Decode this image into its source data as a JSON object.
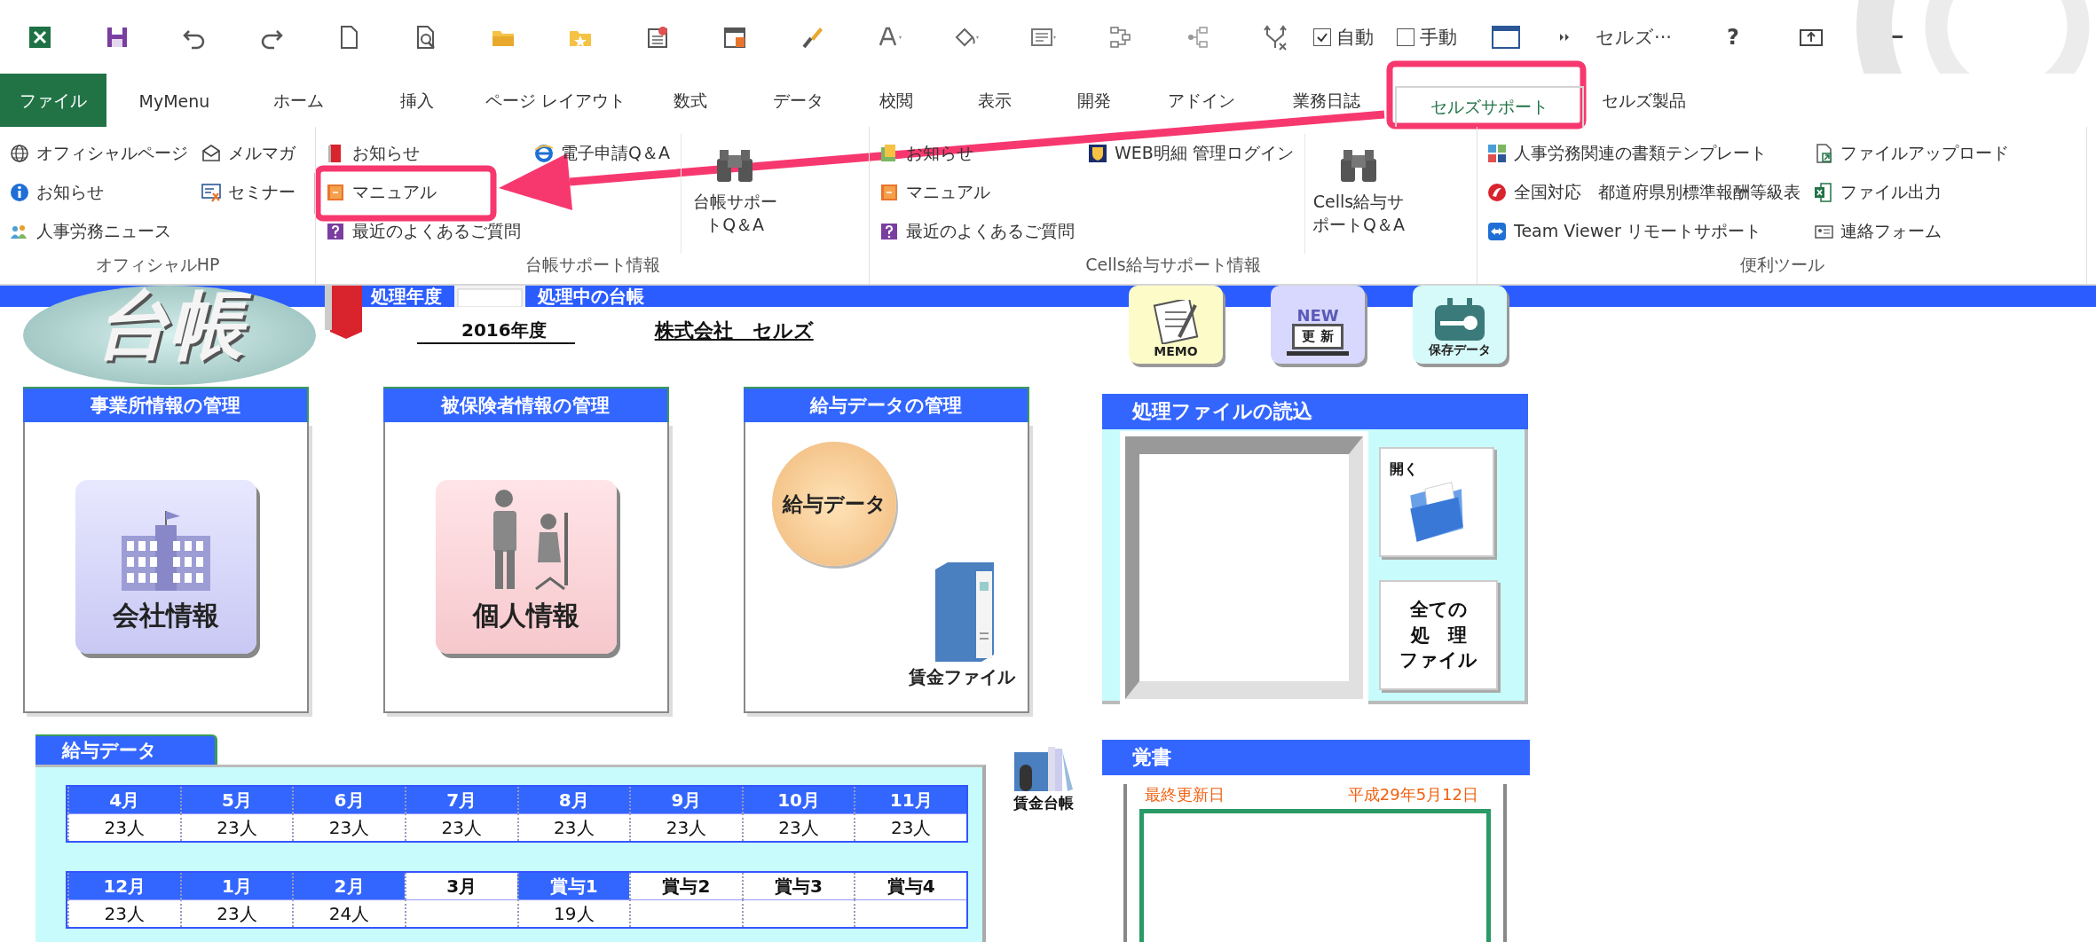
{
  "quick_access": {
    "toggles": [
      {
        "label": "自動",
        "checked": true
      },
      {
        "label": "手動",
        "checked": false
      }
    ],
    "account": "セルズ···",
    "help": "?"
  },
  "tabs": [
    {
      "label": "ファイル",
      "kind": "file",
      "selected": false
    },
    {
      "label": "MyMenu",
      "kind": "tab",
      "selected": false
    },
    {
      "label": "ホーム",
      "kind": "tab",
      "selected": false
    },
    {
      "label": "挿入",
      "kind": "tab",
      "selected": false
    },
    {
      "label": "ページ レイアウト",
      "kind": "tab",
      "selected": false
    },
    {
      "label": "数式",
      "kind": "tab",
      "selected": false
    },
    {
      "label": "データ",
      "kind": "tab",
      "selected": false
    },
    {
      "label": "校閲",
      "kind": "tab",
      "selected": false
    },
    {
      "label": "表示",
      "kind": "tab",
      "selected": false
    },
    {
      "label": "開発",
      "kind": "tab",
      "selected": false
    },
    {
      "label": "アドイン",
      "kind": "tab",
      "selected": false
    },
    {
      "label": "業務日誌",
      "kind": "tab",
      "selected": false
    },
    {
      "label": "セルズサポート",
      "kind": "tab",
      "selected": true
    },
    {
      "label": "セルズ製品",
      "kind": "tab",
      "selected": false
    }
  ],
  "ribbon": {
    "groups": [
      {
        "title": "オフィシャルHP",
        "columns": [
          {
            "kind": "small",
            "items": [
              "オフィシャルページ",
              "お知らせ",
              "人事労務ニュース"
            ]
          },
          {
            "kind": "small",
            "items": [
              "メルマガ",
              "セミナー"
            ]
          }
        ]
      },
      {
        "title": "台帳サポート情報",
        "columns": [
          {
            "kind": "small",
            "items": [
              "お知らせ",
              "マニュアル",
              "最近のよくあるご質問"
            ]
          },
          {
            "kind": "small",
            "items": [
              "電子申請Q＆A"
            ]
          },
          {
            "kind": "large",
            "items": [
              "台帳サポートQ＆A"
            ]
          }
        ]
      },
      {
        "title": "Cells給与サポート情報",
        "columns": [
          {
            "kind": "small",
            "items": [
              "お知らせ",
              "マニュアル",
              "最近のよくあるご質問"
            ]
          },
          {
            "kind": "small",
            "items": [
              "WEB明細 管理ログイン"
            ]
          },
          {
            "kind": "large",
            "items": [
              "Cells給与サポートQ＆A"
            ]
          }
        ]
      },
      {
        "title": "便利ツール",
        "columns": [
          {
            "kind": "small",
            "items": [
              "人事労務関連の書類テンプレート",
              "全国対応　都道府県別標準報酬等級表",
              "Team Viewer リモートサポート"
            ]
          },
          {
            "kind": "small",
            "items": [
              "ファイルアップロード",
              "ファイル出力",
              "連絡フォーム"
            ]
          }
        ]
      }
    ]
  },
  "sheet": {
    "logo": "台帳",
    "header_labels": [
      "処理年度",
      "処理中の台帳"
    ],
    "fiscal_year": "2016年度",
    "company": "株式会社　セルズ",
    "tool_buttons": [
      {
        "label": "MEMO"
      },
      {
        "badge": "NEW",
        "label": "更 新"
      },
      {
        "label": "保存データ"
      }
    ],
    "cards": [
      {
        "title": "事業所情報の管理",
        "buttons": [
          "会社情報"
        ]
      },
      {
        "title": "被保険者情報の管理",
        "buttons": [
          "個人情報"
        ]
      },
      {
        "title": "給与データの管理",
        "buttons": [
          "給与データ",
          "賃金ファイル"
        ]
      }
    ],
    "file_panel": {
      "title": "処理ファイルの読込",
      "open_button": "開く",
      "all_button": [
        "全ての",
        "処　理",
        "ファイル"
      ]
    },
    "memo": {
      "title": "覚書",
      "updated_label": "最終更新日",
      "updated_date": "平成29年5月12日"
    },
    "salary": {
      "title": "給与データ",
      "ledger_label": "賃金台帳",
      "rows": [
        [
          {
            "month": "4月",
            "count": "23人",
            "active": true
          },
          {
            "month": "5月",
            "count": "23人",
            "active": true
          },
          {
            "month": "6月",
            "count": "23人",
            "active": true
          },
          {
            "month": "7月",
            "count": "23人",
            "active": true
          },
          {
            "month": "8月",
            "count": "23人",
            "active": true
          },
          {
            "month": "9月",
            "count": "23人",
            "active": true
          },
          {
            "month": "10月",
            "count": "23人",
            "active": true
          },
          {
            "month": "11月",
            "count": "23人",
            "active": true
          }
        ],
        [
          {
            "month": "12月",
            "count": "23人",
            "active": true
          },
          {
            "month": "1月",
            "count": "23人",
            "active": true
          },
          {
            "month": "2月",
            "count": "24人",
            "active": true
          },
          {
            "month": "3月",
            "active": false
          },
          {
            "month": "賞与1",
            "count": "19人",
            "active": true
          },
          {
            "month": "賞与2",
            "active": false
          },
          {
            "month": "賞与3",
            "active": false
          },
          {
            "month": "賞与4",
            "active": false
          }
        ]
      ]
    }
  }
}
